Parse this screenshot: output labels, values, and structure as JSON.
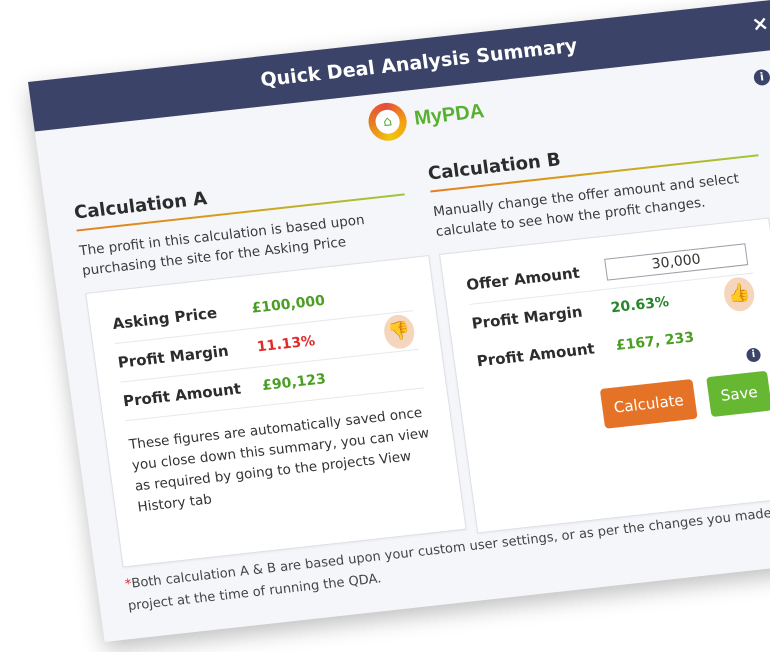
{
  "header": {
    "title": "Quick Deal Analysis Summary",
    "close": "×"
  },
  "logo": {
    "text": "MyPDA",
    "icon": "house-gear-logo"
  },
  "info_icon": "i",
  "calc_a": {
    "title": "Calculation A",
    "description": "The profit in this calculation is based upon purchasing the site for the Asking Price",
    "asking_price_label": "Asking Price",
    "asking_price_value": "£100,000",
    "margin_label": "Profit Margin",
    "margin_value": "11.13%",
    "amount_label": "Profit Amount",
    "amount_value": "£90,123",
    "note": "These figures are automatically saved once you close down this summary, you can view as required by going to the projects View History tab",
    "emoji": "thumbs-down-avatar"
  },
  "calc_b": {
    "title": "Calculation B",
    "description": "Manually change the offer amount and select calculate to see how the profit changes.",
    "offer_label": "Offer Amount",
    "offer_value": "30,000",
    "margin_label": "Profit Margin",
    "margin_value": "20.63%",
    "amount_label": "Profit Amount",
    "amount_value": "£167, 233",
    "calculate_label": "Calculate",
    "save_label": "Save",
    "emoji": "thumbs-up-avatar"
  },
  "footer": {
    "star": "*",
    "text": "Both calculation A & B are based upon your custom user settings, or as per the changes you made to the project at the time of running the QDA."
  },
  "colors": {
    "header": "#3b4468",
    "brand_green": "#58b030",
    "calc_orange": "#e57327",
    "save_green": "#66b832"
  }
}
